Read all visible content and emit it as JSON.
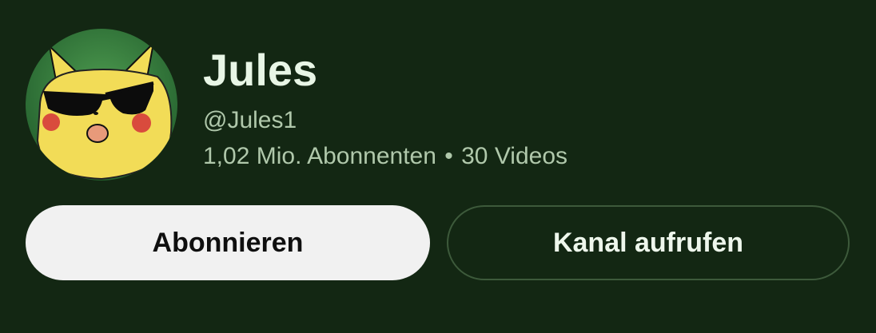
{
  "channel": {
    "name": "Jules",
    "handle": "@Jules1",
    "subscribers": "1,02 Mio. Abonnenten",
    "separator": "•",
    "videos": "30 Videos",
    "avatar_icon": "pikachu-sunglasses-avatar"
  },
  "buttons": {
    "subscribe_label": "Abonnieren",
    "view_channel_label": "Kanal aufrufen"
  },
  "colors": {
    "background": "#132713",
    "subscribe_bg": "#f1f1f1",
    "outline_border": "#3d5a3b"
  }
}
